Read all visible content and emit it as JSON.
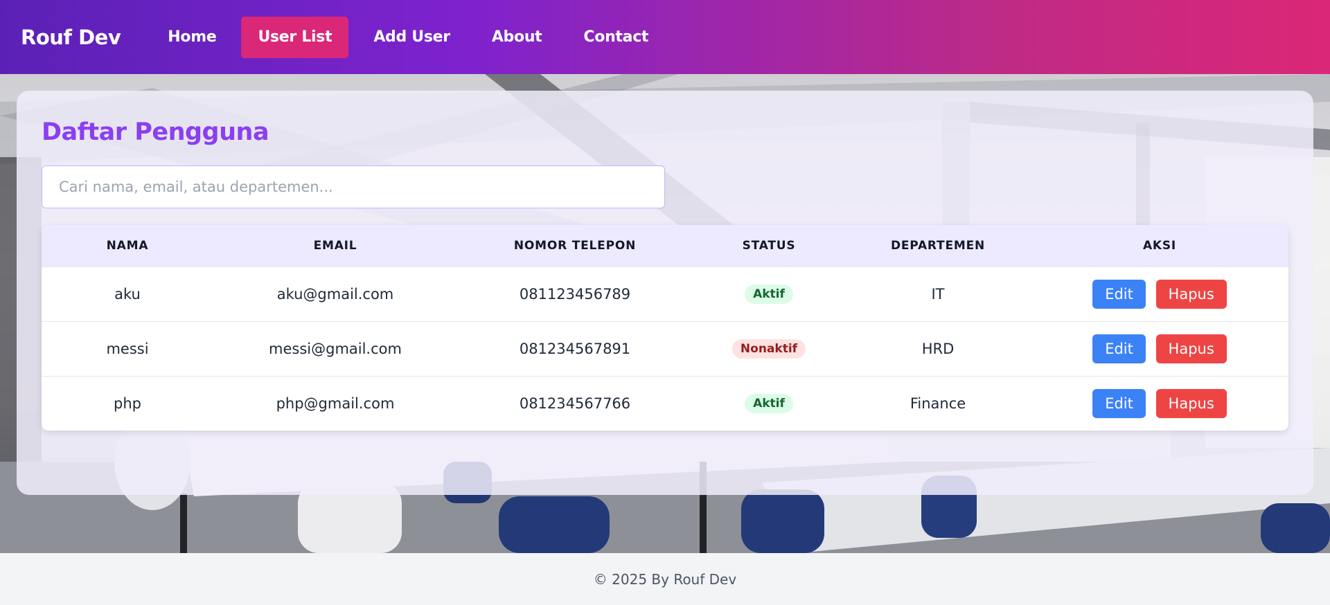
{
  "nav": {
    "brand": "Rouf Dev",
    "links": [
      {
        "label": "Home",
        "active": false
      },
      {
        "label": "User List",
        "active": true
      },
      {
        "label": "Add User",
        "active": false
      },
      {
        "label": "About",
        "active": false
      },
      {
        "label": "Contact",
        "active": false
      }
    ]
  },
  "colors": {
    "nav_gradient_start": "#5b21b6",
    "nav_gradient_end": "#db2777",
    "active_link": "#db2777",
    "title": "#8b3ff0",
    "edit_button": "#3b82f6",
    "delete_button": "#ef4444"
  },
  "main": {
    "title": "Daftar Pengguna",
    "search": {
      "placeholder": "Cari nama, email, atau departemen...",
      "value": ""
    },
    "table": {
      "headers": [
        "NAMA",
        "EMAIL",
        "NOMOR TELEPON",
        "STATUS",
        "DEPARTEMEN",
        "AKSI"
      ],
      "rows": [
        {
          "nama": "aku",
          "email": "aku@gmail.com",
          "telepon": "081123456789",
          "status": "Aktif",
          "departemen": "IT",
          "edit": "Edit",
          "hapus": "Hapus"
        },
        {
          "nama": "messi",
          "email": "messi@gmail.com",
          "telepon": "081234567891",
          "status": "Nonaktif",
          "departemen": "HRD",
          "edit": "Edit",
          "hapus": "Hapus"
        },
        {
          "nama": "php",
          "email": "php@gmail.com",
          "telepon": "081234567766",
          "status": "Aktif",
          "departemen": "Finance",
          "edit": "Edit",
          "hapus": "Hapus"
        }
      ]
    }
  },
  "footer": {
    "text": "© 2025 By Rouf Dev"
  }
}
